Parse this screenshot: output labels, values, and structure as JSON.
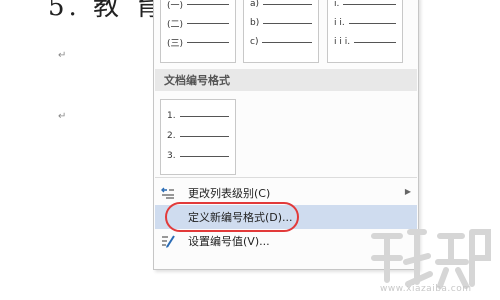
{
  "document": {
    "heading": "5.  教  育",
    "paragraph_marks": [
      "↵",
      "↵"
    ]
  },
  "numbering_menu": {
    "library_thumbnails": [
      [
        "(一)",
        "(二)",
        "(三)"
      ],
      [
        "a)",
        "b)",
        "c)"
      ],
      [
        "i.",
        "i i.",
        "i i i."
      ]
    ],
    "document_formats_header": "文档编号格式",
    "document_format_thumbnail": [
      "1.",
      "2.",
      "3."
    ],
    "items": [
      {
        "label": "更改列表级别(C)",
        "icon": "change-list-level-icon",
        "has_submenu": true
      },
      {
        "label": "定义新编号格式(D)...",
        "icon": "",
        "highlighted": true
      },
      {
        "label": "设置编号值(V)...",
        "icon": "set-numbering-value-icon"
      }
    ]
  },
  "annotation": {
    "color": "#e23a3a"
  },
  "watermark": {
    "url": "www.xiazaiba.com"
  }
}
